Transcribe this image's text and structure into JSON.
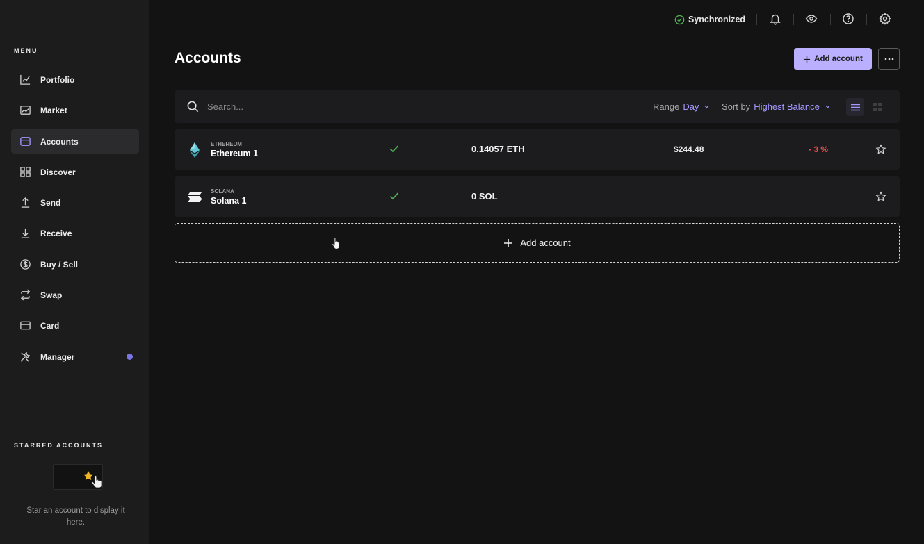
{
  "sidebar": {
    "menu_title": "MENU",
    "items": [
      {
        "label": "Portfolio",
        "icon": "chart-line-icon",
        "active": false
      },
      {
        "label": "Market",
        "icon": "market-chart-icon",
        "active": false
      },
      {
        "label": "Accounts",
        "icon": "wallet-icon",
        "active": true
      },
      {
        "label": "Discover",
        "icon": "grid-icon",
        "active": false
      },
      {
        "label": "Send",
        "icon": "arrow-up-icon",
        "active": false
      },
      {
        "label": "Receive",
        "icon": "arrow-down-icon",
        "active": false
      },
      {
        "label": "Buy / Sell",
        "icon": "dollar-circle-icon",
        "active": false
      },
      {
        "label": "Swap",
        "icon": "swap-icon",
        "active": false
      },
      {
        "label": "Card",
        "icon": "card-icon",
        "active": false
      },
      {
        "label": "Manager",
        "icon": "tools-icon",
        "active": false,
        "notification_dot": true
      }
    ],
    "starred_title": "STARRED ACCOUNTS",
    "starred_empty_text": "Star an account to display it here."
  },
  "topbar": {
    "sync_status": "Synchronized",
    "icons": [
      "bell-icon",
      "eye-icon",
      "help-icon",
      "settings-icon"
    ]
  },
  "page": {
    "title": "Accounts",
    "add_button": "Add account",
    "more_icon": "more-horizontal-icon"
  },
  "filters": {
    "search_placeholder": "Search...",
    "range_label": "Range",
    "range_value": "Day",
    "sort_label": "Sort by",
    "sort_value": "Highest Balance",
    "view_mode": "list"
  },
  "accounts": [
    {
      "currency": "ETHEREUM",
      "name": "Ethereum 1",
      "balance": "0.14057 ETH",
      "fiat": "$244.48",
      "change": "- 3 %",
      "synced": true,
      "starred": false
    },
    {
      "currency": "SOLANA",
      "name": "Solana 1",
      "balance": "0 SOL",
      "fiat": "",
      "change": "",
      "synced": true,
      "starred": false
    }
  ],
  "add_account_row": "Add account",
  "colors": {
    "accent": "#bbb0ff",
    "link": "#a498ff",
    "success": "#4caf50",
    "negative": "#e24d4d",
    "background": "#131313",
    "panel": "#1c1c1e",
    "star": "#f0b429"
  }
}
